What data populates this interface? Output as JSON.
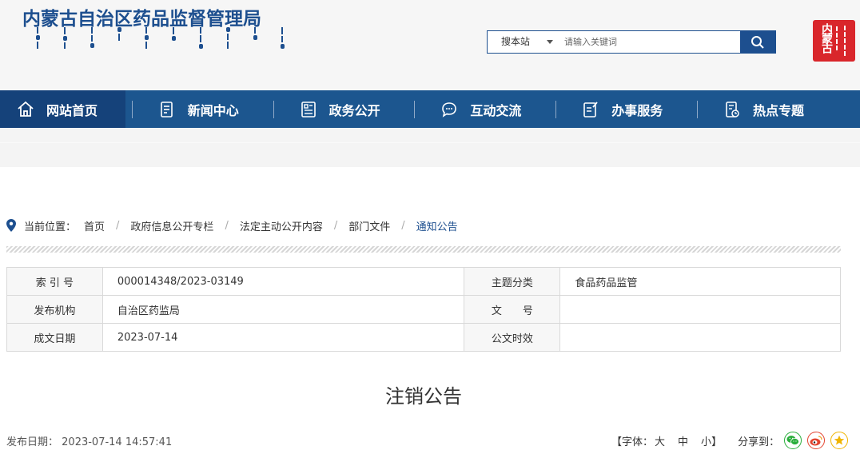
{
  "header": {
    "site_title": "内蒙古自治区药品监督管理局",
    "seal_text": "内蒙古",
    "search": {
      "scope_label": "搜本站",
      "placeholder": "请输入关键词"
    }
  },
  "nav": {
    "items": [
      {
        "label": "网站首页",
        "icon": "home-icon"
      },
      {
        "label": "新闻中心",
        "icon": "document-icon"
      },
      {
        "label": "政务公开",
        "icon": "list-document-icon"
      },
      {
        "label": "互动交流",
        "icon": "chat-bubble-icon"
      },
      {
        "label": "办事服务",
        "icon": "edit-document-icon"
      },
      {
        "label": "热点专题",
        "icon": "clock-document-icon"
      }
    ],
    "active_index": 0
  },
  "breadcrumb": {
    "prefix": "当前位置：",
    "items": [
      "首页",
      "政府信息公开专栏",
      "法定主动公开内容",
      "部门文件",
      "通知公告"
    ],
    "separator": "/"
  },
  "meta": {
    "rows": [
      {
        "l1": "索 引 号",
        "v1": "000014348/2023-03149",
        "l2": "主题分类",
        "v2": "食品药品监管"
      },
      {
        "l1": "发布机构",
        "v1": "自治区药监局",
        "l2": "文　　号",
        "v2": ""
      },
      {
        "l1": "成文日期",
        "v1": "2023-07-14",
        "l2": "公文时效",
        "v2": ""
      }
    ]
  },
  "article": {
    "title": "注销公告",
    "publish_label": "发布日期：",
    "publish_date": "2023-07-14 14:57:41"
  },
  "tools": {
    "font_label": "【字体：",
    "font_large": "大",
    "font_medium": "中",
    "font_small": "小",
    "font_close": "】",
    "share_label": "分享到："
  },
  "colors": {
    "brand_blue": "#1c568f",
    "nav_active": "#15427a",
    "seal_red": "#d9262b",
    "wechat_green": "#2aae3c",
    "weibo_red": "#e3432f",
    "star_yellow": "#f0b400"
  }
}
